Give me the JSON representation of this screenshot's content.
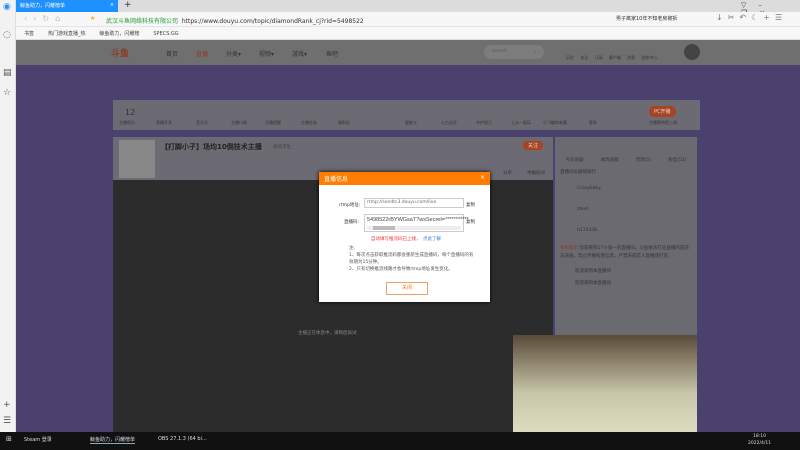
{
  "browser": {
    "tab_title": "鲸鱼助力，闪耀榜单",
    "new_tab": "+",
    "site_name": "武汉斗鱼网络科技有限公司",
    "url": "https://www.douyu.com/topic/diamondRank_cj?rid=5498522",
    "news": "男子离家10年不知老房被拆",
    "bookmarks": [
      "书签",
      "热门游戏直播_热",
      "鲸鱼助力，闪耀榜",
      "SPECS.GG"
    ]
  },
  "header": {
    "logo": "斗鱼",
    "nav": [
      "首页",
      "直播",
      "分类▾",
      "视频▾",
      "游戏▾",
      "鱼吧"
    ],
    "search_placeholder": "search",
    "icons": [
      "历史",
      "关注",
      "订阅",
      "客户端",
      "消息",
      "创作中心"
    ]
  },
  "toolbar": {
    "level": "12",
    "level_label": "主播积分",
    "items": [
      "直播开关",
      "音乐台",
      "主播口袋",
      "开播提醒",
      "主播任务",
      "福利社",
      "星推卡",
      "火力全开",
      "守护保卫",
      "上水一起玩",
      "小飞碟你来猜",
      "更多"
    ],
    "pc_button": "PC开播",
    "pc_sub": "主播等待您上线"
  },
  "room": {
    "title": "【打脚小子】场均10倒技术主播",
    "category": "绝地求生",
    "follow": "关注",
    "share": "分享",
    "report": "举报房间"
  },
  "video": {
    "offline_text": "主播正在休息中，请稍后再试"
  },
  "chat": {
    "tabs": [
      "今日贡献",
      "本周贡献",
      "贵宾(5)",
      "粉丝(51)"
    ],
    "rank_title": "直播间贡献榜排行",
    "users": [
      "Crazybaby",
      "ztesh",
      "h174338"
    ],
    "system_label": "系统提示:",
    "system_msg": "欢迎来到17小鬼一的直播间。斗鱼依法打击直播内容违法违规，禁止传播有害信息，严禁未成年人直播或打赏。",
    "msgs": [
      "欢迎来到本直播间",
      "欢迎来到本直播间"
    ]
  },
  "modal": {
    "title": "直播信息",
    "rtmp_label": "rtmp地址:",
    "rtmp_value": "rtmp://sendtc3.douyu.com/live",
    "key_label": "直播码:",
    "key_value": "5498522rBYWGsaT?wsSecret=***********",
    "copy": "复制",
    "warn": "自动填写推流码已上线，",
    "learn": "点此了解",
    "note_title": "注:",
    "note1": "1、每次点击获取推流码都会重新生成直播码，每个直播码的有效期为15分钟。",
    "note2": "2、只有切换推流线路才会导致rtmp地址发生变化。",
    "close": "关闭"
  },
  "taskbar": {
    "apps": [
      "Steam 登录",
      "鲸鱼助力，闪耀榜单",
      "OBS 27.1.3 (64 bi..."
    ],
    "time": "18:10",
    "date": "2022/4/11"
  }
}
